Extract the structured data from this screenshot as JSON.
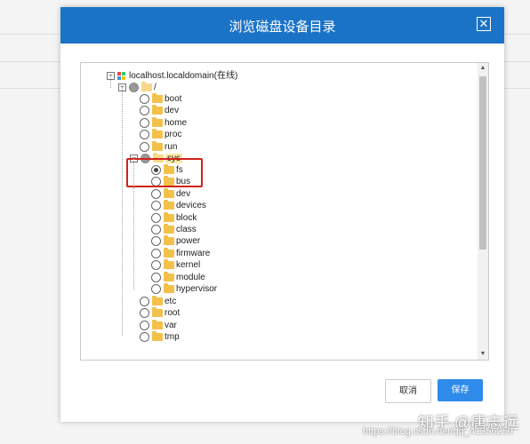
{
  "dialog": {
    "title": "浏览磁盘设备目录",
    "close_glyph": "✕",
    "cancel_label": "取消",
    "save_label": "保存"
  },
  "tree": {
    "root": "localhost.localdomain(在线)",
    "slash": "/",
    "level1_before": [
      "boot",
      "dev",
      "home",
      "proc",
      "run"
    ],
    "sys": "sys",
    "sys_children": [
      "fs",
      "bus",
      "dev",
      "devices",
      "block",
      "class",
      "power",
      "firmware",
      "kernel",
      "module",
      "hypervisor"
    ],
    "level1_after": [
      "etc",
      "root",
      "var",
      "tmp"
    ]
  },
  "watermark": {
    "brand": "知乎 @唐志远",
    "url": "https://blog.csdn.net/qq_41356250"
  },
  "colors": {
    "header": "#1b73c7",
    "save": "#2f8bea",
    "highlight": "#d0221a",
    "folder": "#f3c04a"
  }
}
